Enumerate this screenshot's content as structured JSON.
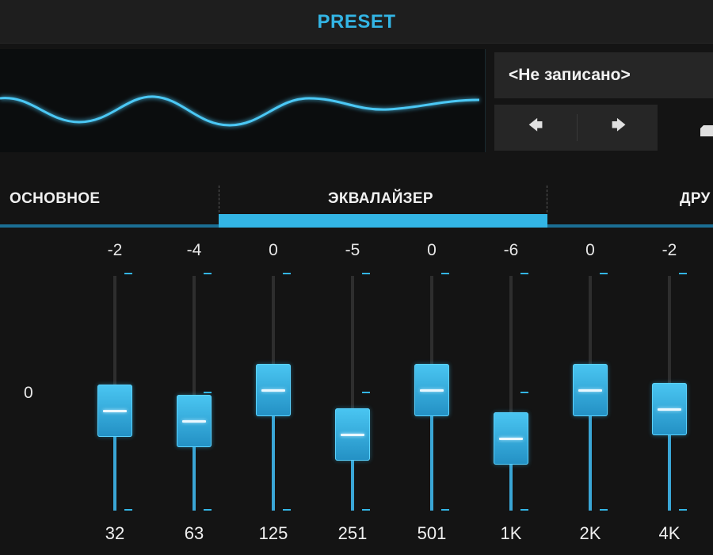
{
  "header": {
    "title": "PRESET"
  },
  "preset": {
    "name": "<Не записано>",
    "prev_label": "🡄",
    "next_label": "🡆"
  },
  "tabs": [
    {
      "label": "ОСНОВНОЕ",
      "active": false
    },
    {
      "label": "ЭКВАЛАЙЗЕР",
      "active": true
    },
    {
      "label": "ДРУ",
      "active": false
    }
  ],
  "equalizer": {
    "zero_label": "0",
    "bands": [
      {
        "freq": "32",
        "value_label": "-2"
      },
      {
        "freq": "63",
        "value_label": "-4"
      },
      {
        "freq": "125",
        "value_label": "0"
      },
      {
        "freq": "251",
        "value_label": "-5"
      },
      {
        "freq": "501",
        "value_label": "0"
      },
      {
        "freq": "1K",
        "value_label": "-6"
      },
      {
        "freq": "2K",
        "value_label": "0"
      },
      {
        "freq": "4K",
        "value_label": "-2"
      }
    ]
  },
  "colors": {
    "accent": "#33b5e5",
    "background": "#141414",
    "panel": "#262626"
  }
}
